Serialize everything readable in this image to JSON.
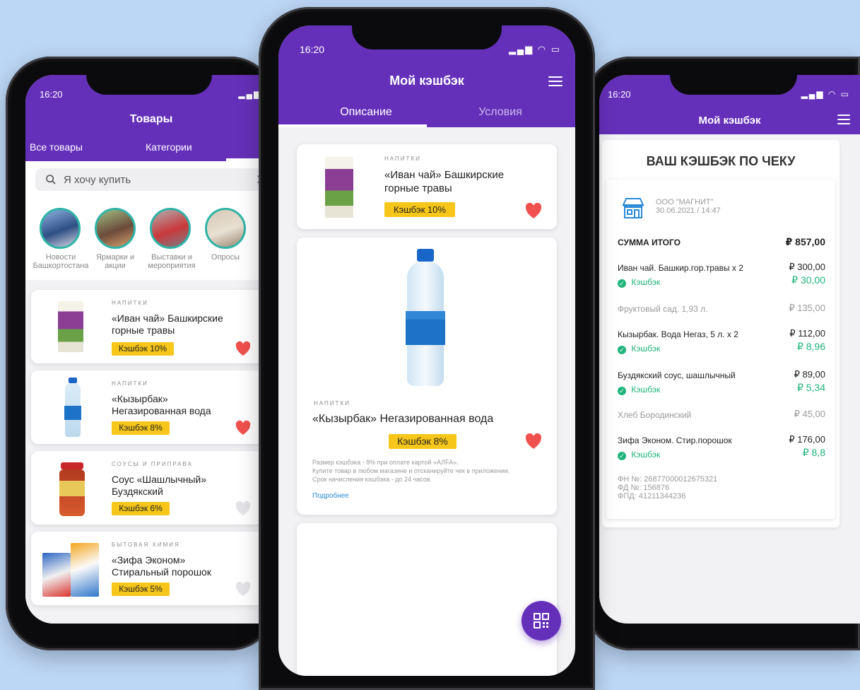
{
  "status": {
    "time": "16:20"
  },
  "left": {
    "title": "Товары",
    "tabs": [
      "Все товары",
      "Категории"
    ],
    "search_placeholder": "Я хочу купить",
    "bubbles": [
      {
        "label": "Новости Башкортостана"
      },
      {
        "label": "Ярмарки и акции"
      },
      {
        "label": "Выставки и мероприятия"
      },
      {
        "label": "Опросы"
      }
    ],
    "products": [
      {
        "category": "Напитки",
        "name_line1": "«Иван чай» Башкирские",
        "name_line2": "горные травы",
        "cashback": "Кэшбэк 10%",
        "favorite": true
      },
      {
        "category": "Напитки",
        "name_line1": "«Кызырбак»",
        "name_line2": "Негазированная вода",
        "cashback": "Кэшбэк 8%",
        "favorite": true
      },
      {
        "category": "Соусы и приправа",
        "name_line1": "Соус «Шашлычный»",
        "name_line2": "Буздякский",
        "cashback": "Кэшбэк 6%",
        "favorite": false
      },
      {
        "category": "Бытовая химия",
        "name_line1": "«Зифа Эконом»",
        "name_line2": "Стиральный порошок",
        "cashback": "Кэшбэк 5%",
        "favorite": false
      }
    ]
  },
  "center": {
    "title": "Мой кэшбэк",
    "tabs": [
      "Описание",
      "Условия"
    ],
    "card1": {
      "category": "Напитки",
      "name_line1": "«Иван чай» Башкирские",
      "name_line2": "горные травы",
      "cashback": "Кэшбэк 10%"
    },
    "card2": {
      "category": "Напитки",
      "name": "«Кызырбак» Негазированная вода",
      "cashback": "Кэшбэк 8%",
      "desc_line1": "Размер кэшбэка - 8% при оплате картой «АЛFA».",
      "desc_line2": "Купите товар в любом магазине и отсканируйте чек в приложении.",
      "desc_line3": "Срок начисления кэшбэка - до 24 часов.",
      "more_link": "Подробнее"
    }
  },
  "right": {
    "title": "Мой кэшбэк",
    "receipt_title": "ВАШ КЭШБЭК ПО ЧЕКУ",
    "shop_name": "ООО \"МАГНИТ\"",
    "shop_date": "30.06.2021 / 14:47",
    "total_label": "СУММА ИТОГО",
    "total_value": "₽ 857,00",
    "items": [
      {
        "name": "Иван чай. Башкир.гор.травы х 2",
        "price": "₽ 300,00",
        "cashback_label": "Кэшбэк",
        "cashback": "₽ 30,00"
      },
      {
        "name": "Фруктовый сад. 1,93 л.",
        "price": "₽ 135,00"
      },
      {
        "name": "Кызырбак. Вода Негаз, 5 л. х 2",
        "price": "₽ 112,00",
        "cashback_label": "Кэшбэк",
        "cashback": "₽ 8,96"
      },
      {
        "name": "Буздякский соус, шашлычный",
        "price": "₽ 89,00",
        "cashback_label": "Кэшбэк",
        "cashback": "₽ 5,34"
      },
      {
        "name": "Хлеб Бородинский",
        "price": "₽ 45,00"
      },
      {
        "name": "Зифа Эконом. Стир.порошок",
        "price": "₽ 176,00",
        "cashback_label": "Кэшбэк",
        "cashback": "₽ 8,8"
      }
    ],
    "fiscal": [
      "ФН №: 26877000012675321",
      "ФД №: 156876",
      "ФПД: 41211344236"
    ]
  },
  "colors": {
    "brand": "#6530b9",
    "badge": "#f6c61a",
    "heart_active": "#f0514e",
    "cashback_green": "#1fb47a",
    "background": "#bcd6f5"
  }
}
